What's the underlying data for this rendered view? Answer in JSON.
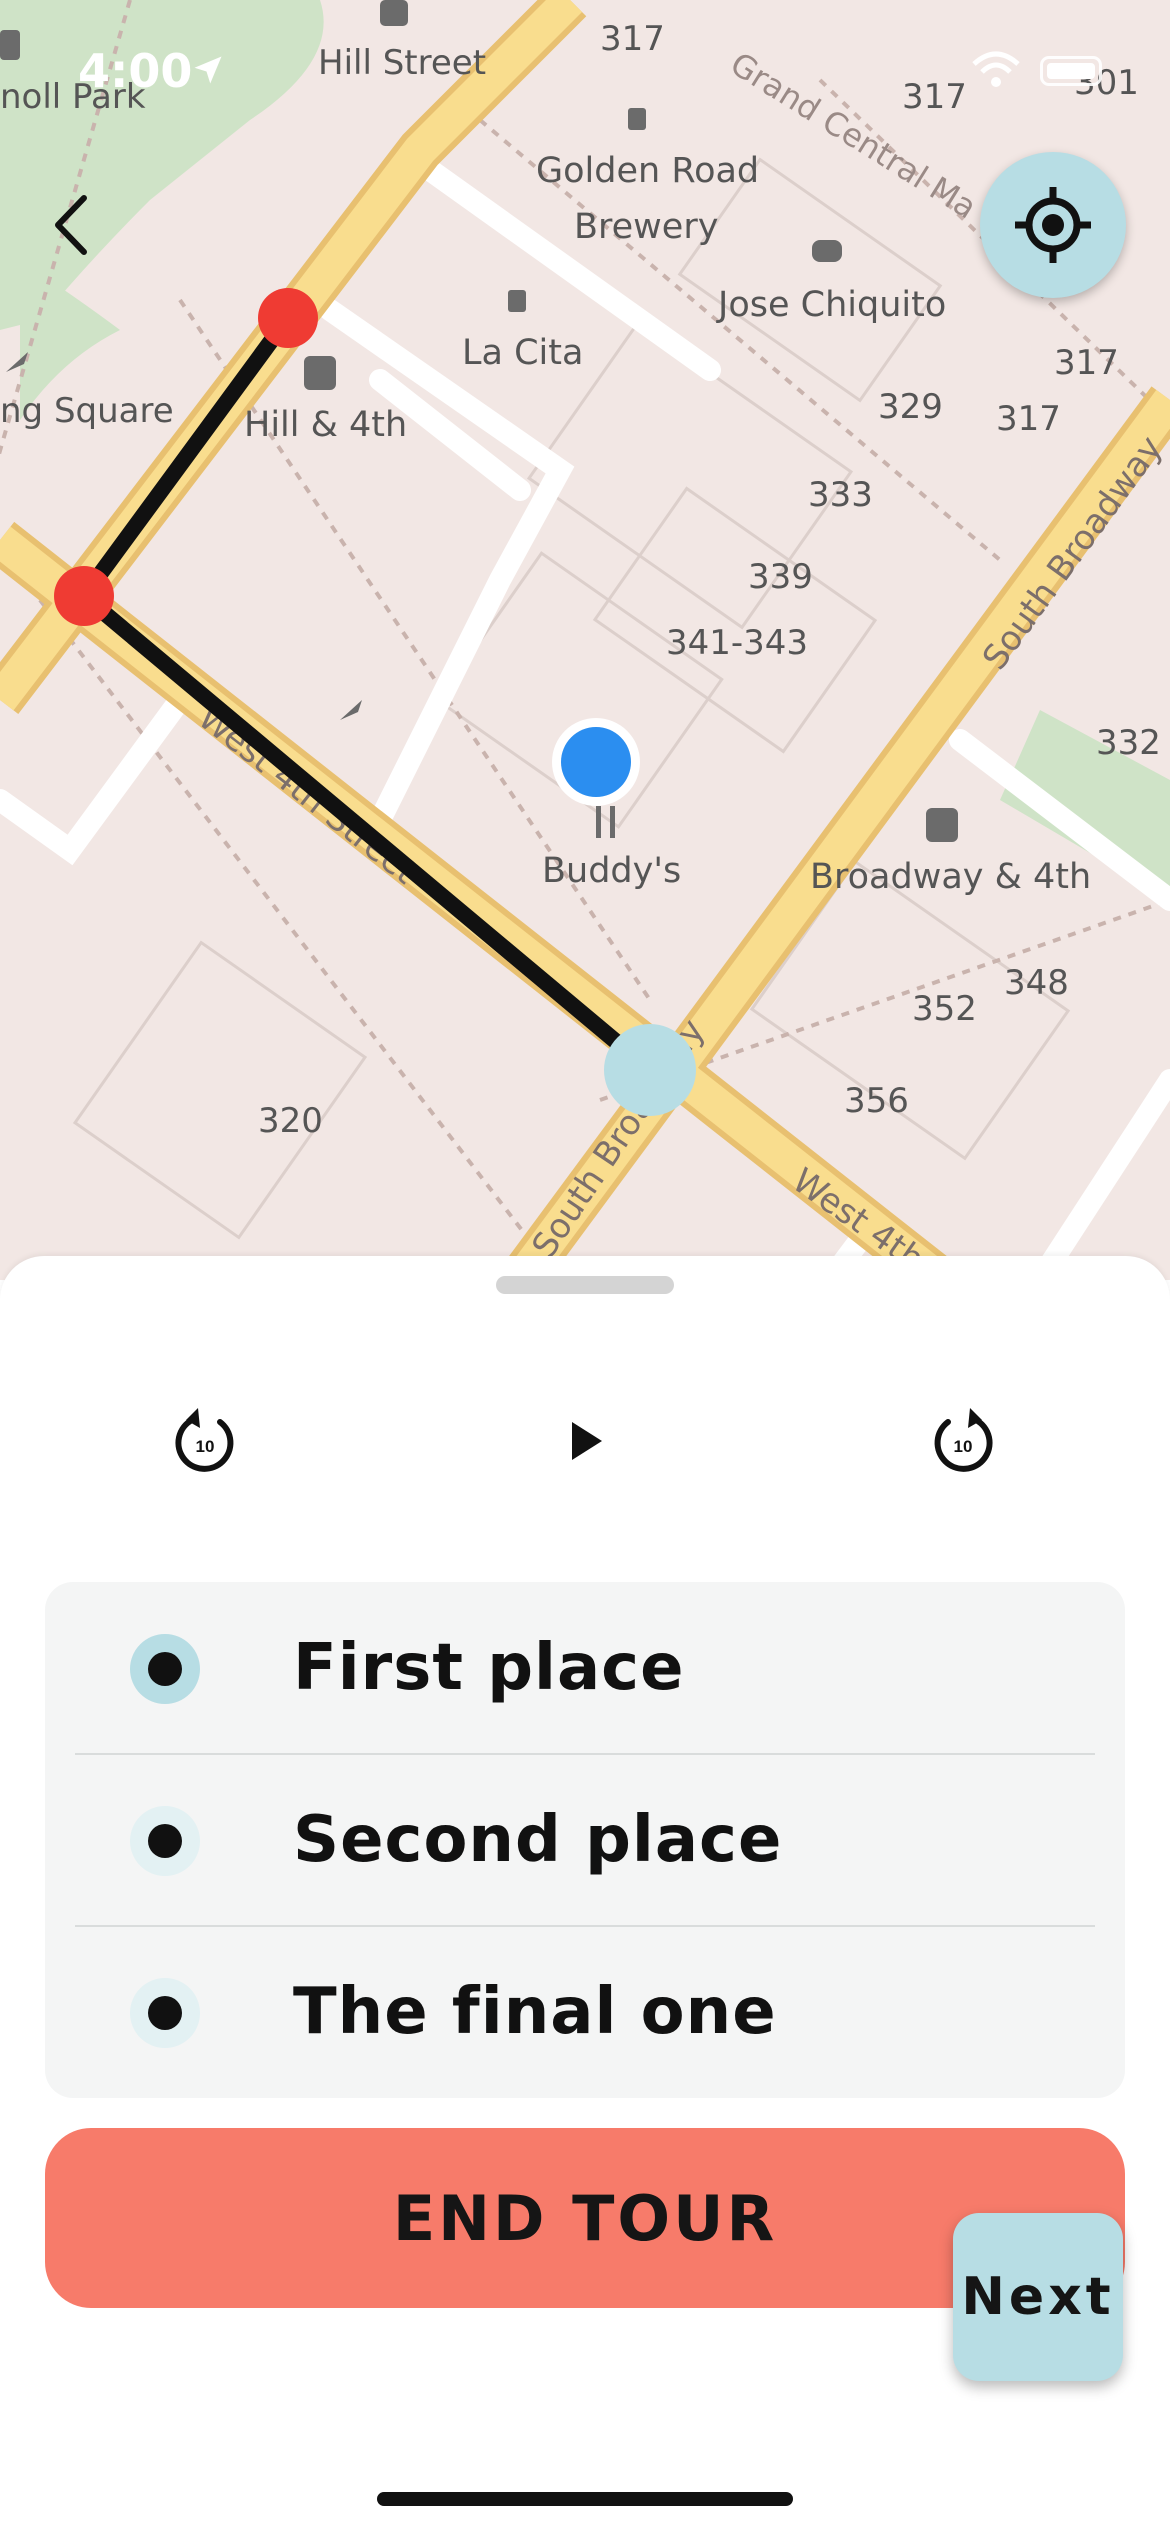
{
  "status_bar": {
    "time": "4:00"
  },
  "map": {
    "labels": {
      "park": "noll Park",
      "hill_street": "Hill Street",
      "square": "ng Square",
      "golden_road": "Golden Road",
      "brewery": "Brewery",
      "grand_central": "Grand Central Ma",
      "jose_chiquito": "Jose Chiquito",
      "la_cita": "La Cita",
      "hill_4th": "Hill & 4th",
      "buddys": "Buddy's",
      "broadway_4th": "Broadway & 4th",
      "west_4th_street": "West 4th Street",
      "south_broadway": "South Broadway",
      "south_broadway_2": "South Broadway",
      "west_4th_2": "West 4th",
      "n317a": "317",
      "n317b": "317",
      "n317c": "317",
      "n317d": "317",
      "n301": "301",
      "n329": "329",
      "n333": "333",
      "n339": "339",
      "n341": "341-343",
      "n332": "332",
      "n352": "352",
      "n348": "348",
      "n356": "356",
      "n320": "320"
    }
  },
  "player": {
    "rewind_label": "10",
    "forward_label": "10"
  },
  "stops": [
    {
      "label": "First place"
    },
    {
      "label": "Second place"
    },
    {
      "label": "The final one"
    }
  ],
  "end_tour_label": "END TOUR",
  "next_label": "Next",
  "colors": {
    "accent_light_blue": "#b7dde4",
    "end_button": "#f77b6a",
    "route_point_red": "#ef3b33",
    "user_location_blue": "#2b8ef0"
  }
}
